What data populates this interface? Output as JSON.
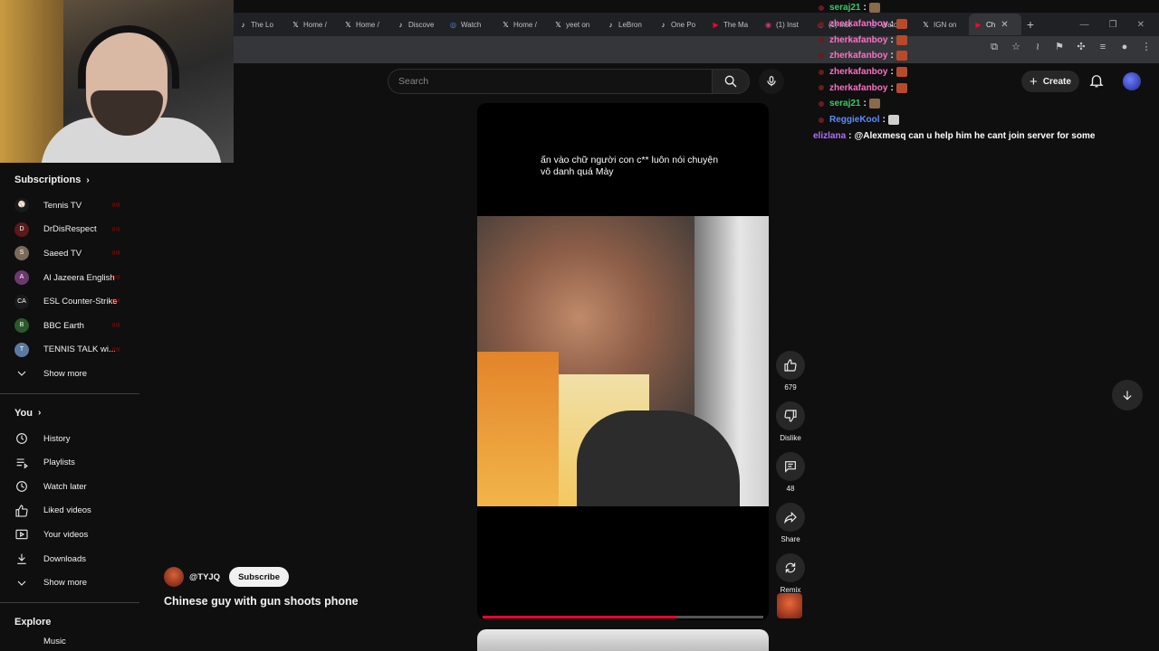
{
  "browser": {
    "tabs": [
      {
        "label": "The Lo",
        "icon": "tiktok-icon",
        "color": "#ffffff"
      },
      {
        "label": "Home /",
        "icon": "x-icon",
        "color": "#ffffff"
      },
      {
        "label": "Home /",
        "icon": "x-icon",
        "color": "#ffffff"
      },
      {
        "label": "Discove",
        "icon": "tiktok-icon",
        "color": "#ffffff"
      },
      {
        "label": "Watch",
        "icon": "watch-icon",
        "color": "#4a8cff"
      },
      {
        "label": "Home /",
        "icon": "x-icon",
        "color": "#ffffff"
      },
      {
        "label": "yeet on",
        "icon": "x-icon",
        "color": "#ffffff"
      },
      {
        "label": "LeBron",
        "icon": "tiktok-icon",
        "color": "#ffffff"
      },
      {
        "label": "One Po",
        "icon": "tiktok-icon",
        "color": "#ffffff"
      },
      {
        "label": "The Ma",
        "icon": "youtube-icon",
        "color": "#ff0033"
      },
      {
        "label": "(1) Inst",
        "icon": "instagram-icon",
        "color": "#e1306c"
      },
      {
        "label": "(1) Inst",
        "icon": "instagram-icon",
        "color": "#e1306c"
      },
      {
        "label": "Watch",
        "icon": "watch-icon",
        "color": "#4a8cff"
      },
      {
        "label": "IGN on",
        "icon": "x-icon",
        "color": "#ffffff"
      },
      {
        "label": "Ch",
        "icon": "youtube-icon",
        "color": "#ff0033",
        "active": true
      }
    ],
    "new_tab": "+",
    "window_controls": [
      "—",
      "❐",
      "✕"
    ]
  },
  "header": {
    "search_placeholder": "Search",
    "create_label": "Create"
  },
  "chat": {
    "lines": [
      {
        "user": "seraj21",
        "color": "green",
        "message": ""
      },
      {
        "user": "zherkafanboy",
        "color": "red",
        "message": ""
      },
      {
        "user": "zherkafanboy",
        "color": "red",
        "message": ""
      },
      {
        "user": "zherkafanboy",
        "color": "red",
        "message": ""
      },
      {
        "user": "zherkafanboy",
        "color": "red",
        "message": ""
      },
      {
        "user": "zherkafanboy",
        "color": "red",
        "message": ""
      },
      {
        "user": "seraj21",
        "color": "green",
        "message": ""
      },
      {
        "user": "ReggieKool",
        "color": "blue",
        "message": ""
      },
      {
        "user": "elizlana",
        "color": "purple",
        "message": "@Alexmesq can u help him he cant join server for some"
      }
    ]
  },
  "sidebar": {
    "subscriptions_title": "Subscriptions",
    "subscriptions": [
      {
        "name": "Tennis TV",
        "avatar_color": "#1a1a1a",
        "glyph": "⚾"
      },
      {
        "name": "DrDisRespect",
        "avatar_color": "#5a1a1a",
        "glyph": "D"
      },
      {
        "name": "Saeed TV",
        "avatar_color": "#7a6a5a",
        "glyph": "S"
      },
      {
        "name": "Al Jazeera English",
        "avatar_color": "#6a3a6a",
        "glyph": "A"
      },
      {
        "name": "ESL Counter-Strike",
        "avatar_color": "#1a1a1a",
        "glyph": "CA"
      },
      {
        "name": "BBC Earth",
        "avatar_color": "#2a5a2a",
        "glyph": "B"
      },
      {
        "name": "TENNIS TALK wi...",
        "avatar_color": "#5a7aa0",
        "glyph": "T"
      }
    ],
    "show_more_1": "Show more",
    "you_title": "You",
    "you_items": [
      {
        "label": "History",
        "icon": "history-icon"
      },
      {
        "label": "Playlists",
        "icon": "playlists-icon"
      },
      {
        "label": "Watch later",
        "icon": "watch-later-icon"
      },
      {
        "label": "Liked videos",
        "icon": "like-icon"
      },
      {
        "label": "Your videos",
        "icon": "your-videos-icon"
      },
      {
        "label": "Downloads",
        "icon": "download-icon"
      }
    ],
    "show_more_2": "Show more",
    "explore_title": "Explore",
    "explore_first": "Music"
  },
  "short": {
    "caption": "ấn vào chữ người con c** luôn nói chuyện vô danh quá Mày",
    "progress_percent": 69,
    "channel": "@TYJQ",
    "subscribe_label": "Subscribe",
    "title": "Chinese guy with gun shoots phone",
    "actions": {
      "likes": "679",
      "dislike_label": "Dislike",
      "comments": "48",
      "share_label": "Share",
      "remix_label": "Remix"
    }
  }
}
